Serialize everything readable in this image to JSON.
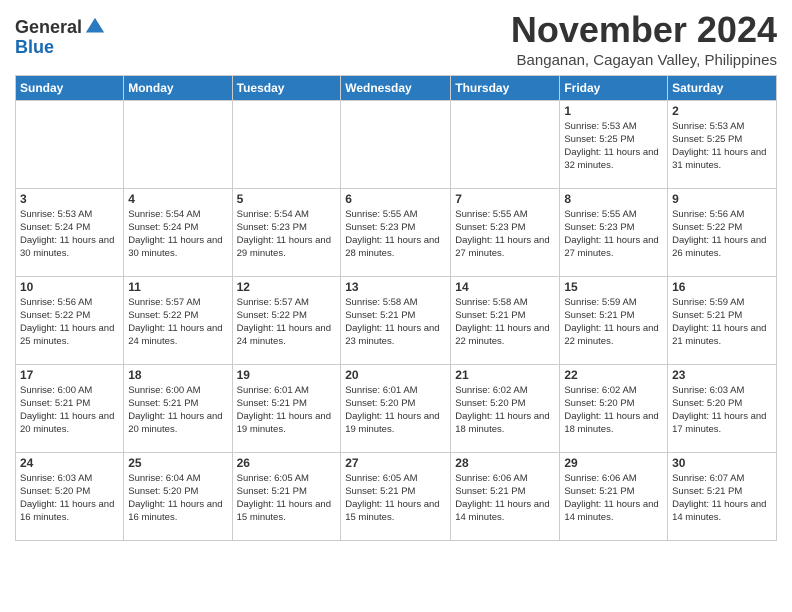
{
  "logo": {
    "general": "General",
    "blue": "Blue"
  },
  "title": "November 2024",
  "location": "Banganan, Cagayan Valley, Philippines",
  "headers": [
    "Sunday",
    "Monday",
    "Tuesday",
    "Wednesday",
    "Thursday",
    "Friday",
    "Saturday"
  ],
  "weeks": [
    [
      {
        "day": "",
        "info": ""
      },
      {
        "day": "",
        "info": ""
      },
      {
        "day": "",
        "info": ""
      },
      {
        "day": "",
        "info": ""
      },
      {
        "day": "",
        "info": ""
      },
      {
        "day": "1",
        "info": "Sunrise: 5:53 AM\nSunset: 5:25 PM\nDaylight: 11 hours\nand 32 minutes."
      },
      {
        "day": "2",
        "info": "Sunrise: 5:53 AM\nSunset: 5:25 PM\nDaylight: 11 hours\nand 31 minutes."
      }
    ],
    [
      {
        "day": "3",
        "info": "Sunrise: 5:53 AM\nSunset: 5:24 PM\nDaylight: 11 hours\nand 30 minutes."
      },
      {
        "day": "4",
        "info": "Sunrise: 5:54 AM\nSunset: 5:24 PM\nDaylight: 11 hours\nand 30 minutes."
      },
      {
        "day": "5",
        "info": "Sunrise: 5:54 AM\nSunset: 5:23 PM\nDaylight: 11 hours\nand 29 minutes."
      },
      {
        "day": "6",
        "info": "Sunrise: 5:55 AM\nSunset: 5:23 PM\nDaylight: 11 hours\nand 28 minutes."
      },
      {
        "day": "7",
        "info": "Sunrise: 5:55 AM\nSunset: 5:23 PM\nDaylight: 11 hours\nand 27 minutes."
      },
      {
        "day": "8",
        "info": "Sunrise: 5:55 AM\nSunset: 5:23 PM\nDaylight: 11 hours\nand 27 minutes."
      },
      {
        "day": "9",
        "info": "Sunrise: 5:56 AM\nSunset: 5:22 PM\nDaylight: 11 hours\nand 26 minutes."
      }
    ],
    [
      {
        "day": "10",
        "info": "Sunrise: 5:56 AM\nSunset: 5:22 PM\nDaylight: 11 hours\nand 25 minutes."
      },
      {
        "day": "11",
        "info": "Sunrise: 5:57 AM\nSunset: 5:22 PM\nDaylight: 11 hours\nand 24 minutes."
      },
      {
        "day": "12",
        "info": "Sunrise: 5:57 AM\nSunset: 5:22 PM\nDaylight: 11 hours\nand 24 minutes."
      },
      {
        "day": "13",
        "info": "Sunrise: 5:58 AM\nSunset: 5:21 PM\nDaylight: 11 hours\nand 23 minutes."
      },
      {
        "day": "14",
        "info": "Sunrise: 5:58 AM\nSunset: 5:21 PM\nDaylight: 11 hours\nand 22 minutes."
      },
      {
        "day": "15",
        "info": "Sunrise: 5:59 AM\nSunset: 5:21 PM\nDaylight: 11 hours\nand 22 minutes."
      },
      {
        "day": "16",
        "info": "Sunrise: 5:59 AM\nSunset: 5:21 PM\nDaylight: 11 hours\nand 21 minutes."
      }
    ],
    [
      {
        "day": "17",
        "info": "Sunrise: 6:00 AM\nSunset: 5:21 PM\nDaylight: 11 hours\nand 20 minutes."
      },
      {
        "day": "18",
        "info": "Sunrise: 6:00 AM\nSunset: 5:21 PM\nDaylight: 11 hours\nand 20 minutes."
      },
      {
        "day": "19",
        "info": "Sunrise: 6:01 AM\nSunset: 5:21 PM\nDaylight: 11 hours\nand 19 minutes."
      },
      {
        "day": "20",
        "info": "Sunrise: 6:01 AM\nSunset: 5:20 PM\nDaylight: 11 hours\nand 19 minutes."
      },
      {
        "day": "21",
        "info": "Sunrise: 6:02 AM\nSunset: 5:20 PM\nDaylight: 11 hours\nand 18 minutes."
      },
      {
        "day": "22",
        "info": "Sunrise: 6:02 AM\nSunset: 5:20 PM\nDaylight: 11 hours\nand 18 minutes."
      },
      {
        "day": "23",
        "info": "Sunrise: 6:03 AM\nSunset: 5:20 PM\nDaylight: 11 hours\nand 17 minutes."
      }
    ],
    [
      {
        "day": "24",
        "info": "Sunrise: 6:03 AM\nSunset: 5:20 PM\nDaylight: 11 hours\nand 16 minutes."
      },
      {
        "day": "25",
        "info": "Sunrise: 6:04 AM\nSunset: 5:20 PM\nDaylight: 11 hours\nand 16 minutes."
      },
      {
        "day": "26",
        "info": "Sunrise: 6:05 AM\nSunset: 5:21 PM\nDaylight: 11 hours\nand 15 minutes."
      },
      {
        "day": "27",
        "info": "Sunrise: 6:05 AM\nSunset: 5:21 PM\nDaylight: 11 hours\nand 15 minutes."
      },
      {
        "day": "28",
        "info": "Sunrise: 6:06 AM\nSunset: 5:21 PM\nDaylight: 11 hours\nand 14 minutes."
      },
      {
        "day": "29",
        "info": "Sunrise: 6:06 AM\nSunset: 5:21 PM\nDaylight: 11 hours\nand 14 minutes."
      },
      {
        "day": "30",
        "info": "Sunrise: 6:07 AM\nSunset: 5:21 PM\nDaylight: 11 hours\nand 14 minutes."
      }
    ]
  ]
}
